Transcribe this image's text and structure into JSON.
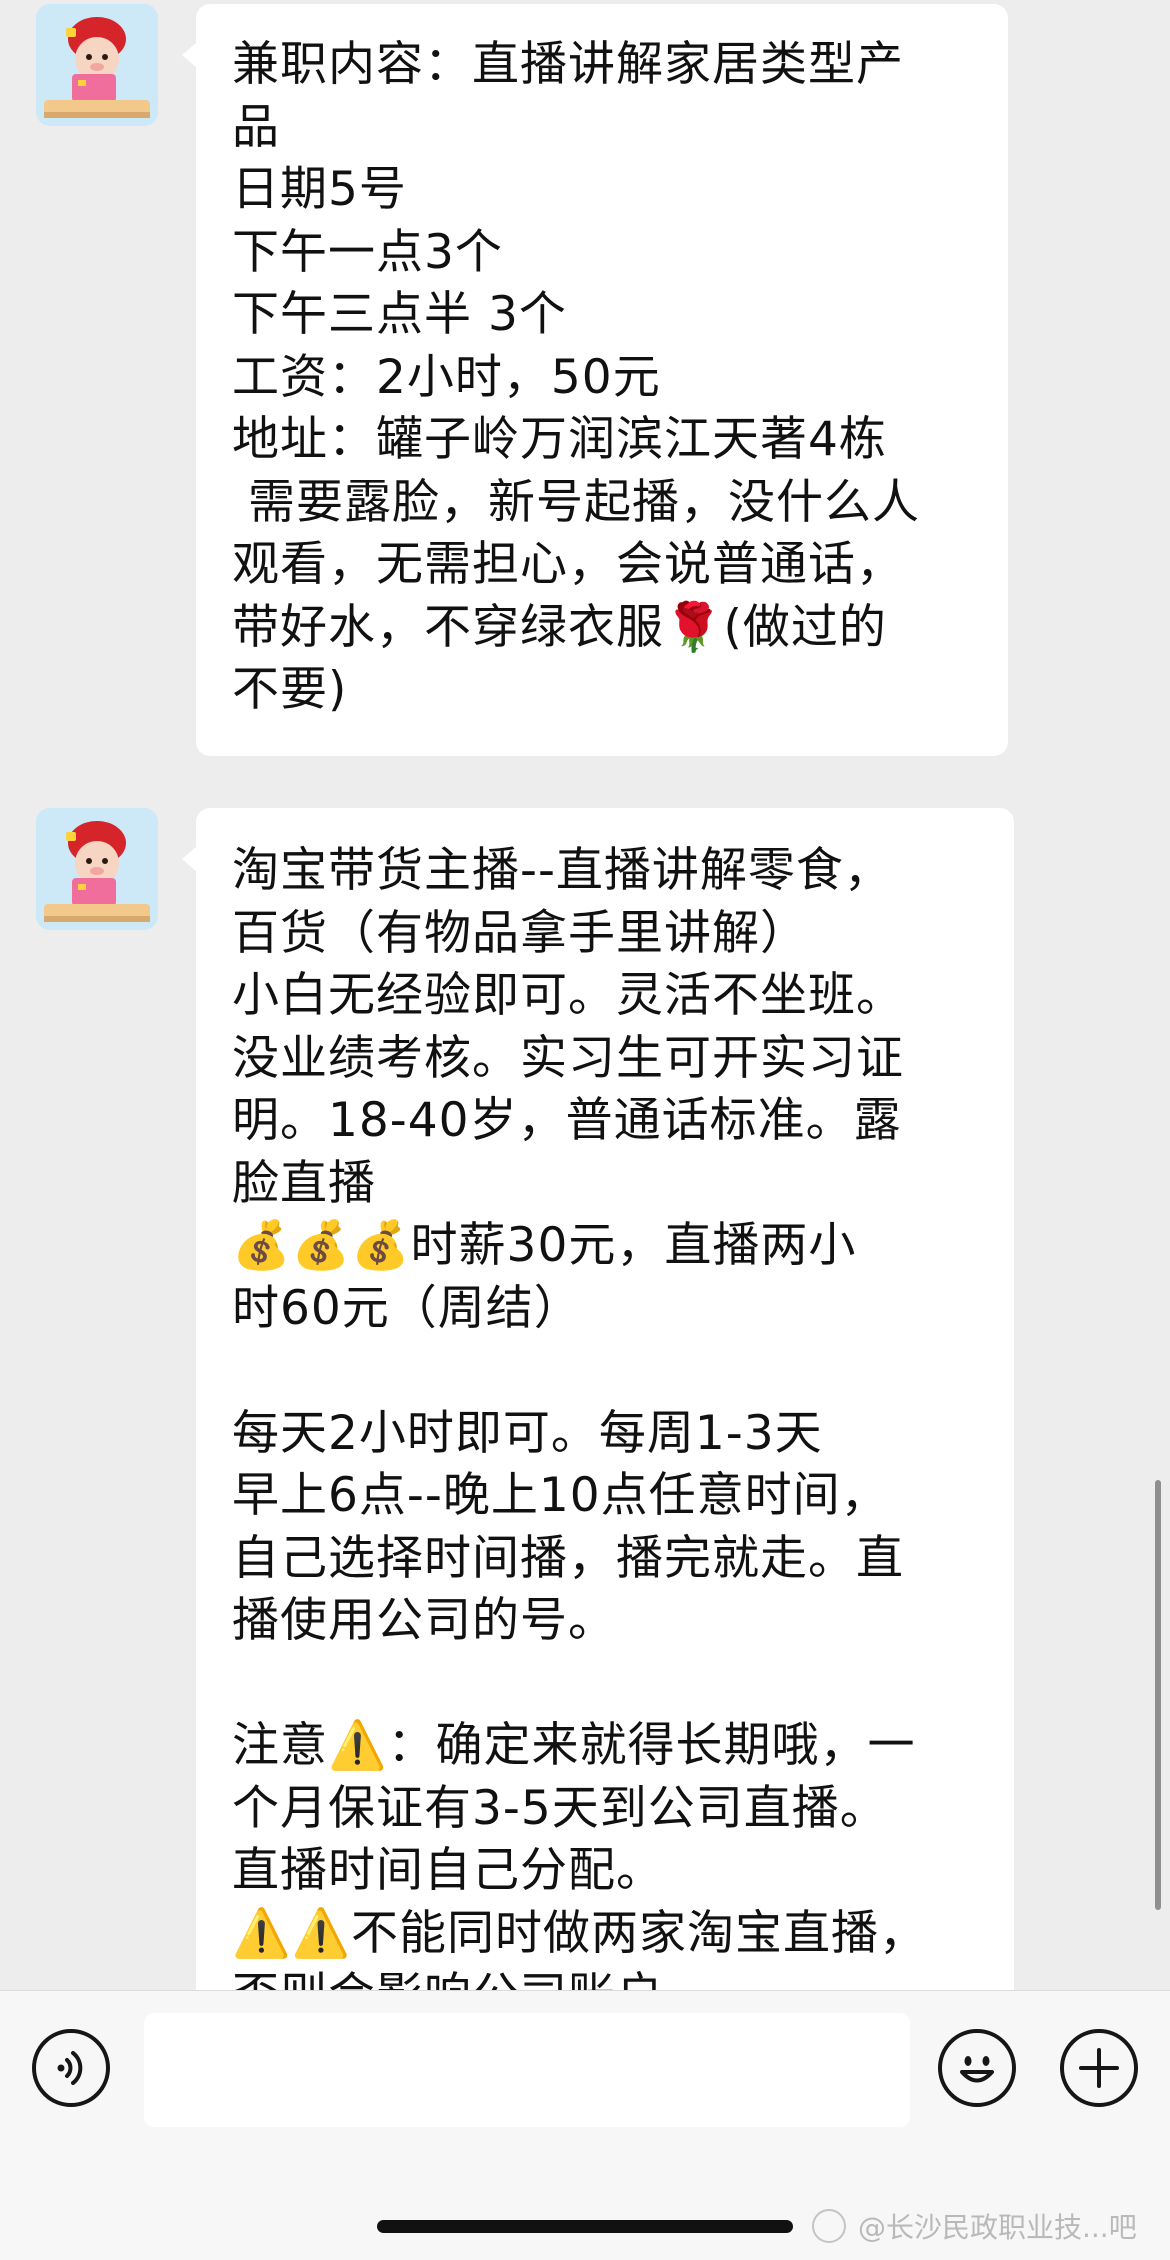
{
  "messages": [
    {
      "sender": "avatar-girl",
      "lines": [
        "兼职内容：直播讲解家居类型产",
        "品",
        "日期5号",
        "下午一点3个",
        "下午三点半 3个",
        "工资：2小时，50元",
        "地址：罐子岭万润滨江天著4栋",
        " 需要露脸，新号起播，没什么人",
        "观看，无需担心，会说普通话，",
        "带好水，不穿绿衣服🌹(做过的",
        "不要)"
      ]
    },
    {
      "sender": "avatar-girl",
      "lines": [
        "淘宝带货主播--直播讲解零食，",
        "百货（有物品拿手里讲解）",
        "小白无经验即可。灵活不坐班。",
        "没业绩考核。实习生可开实习证",
        "明。18-40岁，普通话标准。露",
        "脸直播",
        "💰💰💰时薪30元，直播两小",
        "时60元（周结）",
        "",
        "每天2小时即可。每周1-3天",
        "早上6点--晚上10点任意时间，",
        "自己选择时间播，播完就走。直",
        "播使用公司的号。",
        "",
        "注意⚠️：确定来就得长期哦，一",
        "个月保证有3-5天到公司直播。",
        "直播时间自己分配。",
        "⚠️⚠️不能同时做两家淘宝直播，",
        "否则会影响公司账户"
      ]
    }
  ],
  "input_bar": {
    "voice_icon": "voice-icon",
    "emoji_icon": "smiley-icon",
    "plus_icon": "plus-icon",
    "text_value": ""
  },
  "watermark": "@长沙民政职业技...吧",
  "colors": {
    "chat_bg": "#ededed",
    "bubble_bg": "#ffffff",
    "input_bar_bg": "#f7f7f7"
  }
}
